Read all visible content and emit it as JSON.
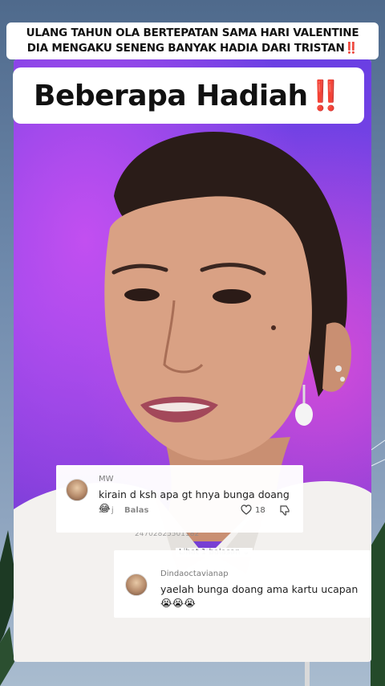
{
  "caption": {
    "line1": "ULANG TAHUN OLA BERTEPATAN SAMA HARI VALENTINE",
    "line2": "DIA MENGAKU SENENG BANYAK HADIA DARI TRISTAN‼️"
  },
  "title": {
    "text": "Beberapa Hadiah",
    "emoji": "‼️"
  },
  "comments": [
    {
      "username": "MW",
      "text": "kirain d ksh apa gt hnya bunga doang😂",
      "time": "23 j",
      "reply_label": "Balas",
      "likes": "18"
    },
    {
      "username": "Dindaoctavianap",
      "text": "yaelah bunga doang ama kartu ucapan 😭😭😭"
    }
  ],
  "view_replies": "Lihat 1 balasan ⌄",
  "partial_line": "24702825501182",
  "colors": {
    "caption_bg": "#ffffff",
    "exclaim_red": "#e0212a",
    "studio_purple": "#7a3dd9"
  },
  "icons": [
    "heart-icon",
    "dislike-icon",
    "avatar"
  ]
}
